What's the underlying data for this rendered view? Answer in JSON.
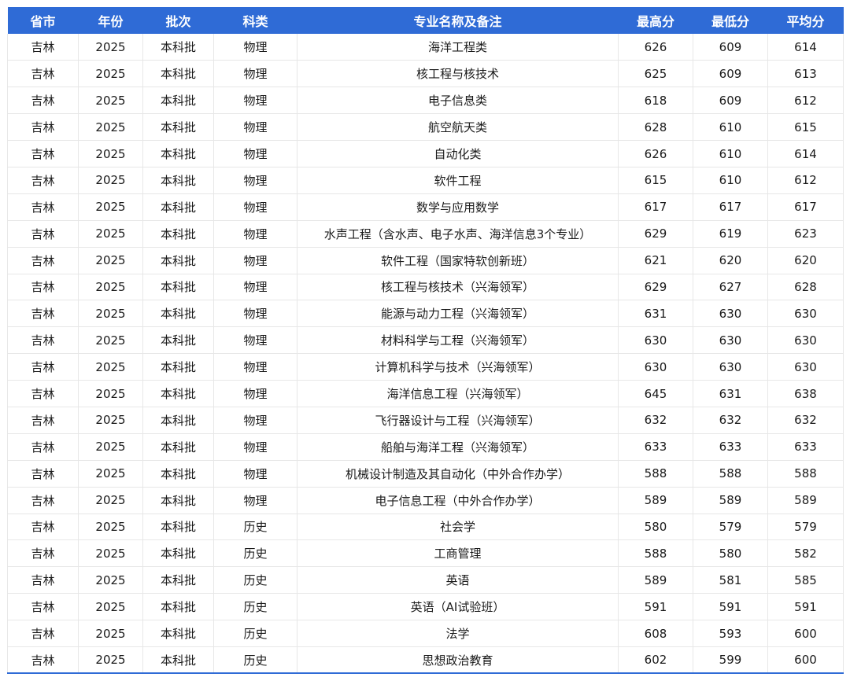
{
  "table": {
    "headers": [
      "省市",
      "年份",
      "批次",
      "科类",
      "专业名称及备注",
      "最高分",
      "最低分",
      "平均分"
    ],
    "rows": [
      [
        "吉林",
        "2025",
        "本科批",
        "物理",
        "海洋工程类",
        "626",
        "609",
        "614"
      ],
      [
        "吉林",
        "2025",
        "本科批",
        "物理",
        "核工程与核技术",
        "625",
        "609",
        "613"
      ],
      [
        "吉林",
        "2025",
        "本科批",
        "物理",
        "电子信息类",
        "618",
        "609",
        "612"
      ],
      [
        "吉林",
        "2025",
        "本科批",
        "物理",
        "航空航天类",
        "628",
        "610",
        "615"
      ],
      [
        "吉林",
        "2025",
        "本科批",
        "物理",
        "自动化类",
        "626",
        "610",
        "614"
      ],
      [
        "吉林",
        "2025",
        "本科批",
        "物理",
        "软件工程",
        "615",
        "610",
        "612"
      ],
      [
        "吉林",
        "2025",
        "本科批",
        "物理",
        "数学与应用数学",
        "617",
        "617",
        "617"
      ],
      [
        "吉林",
        "2025",
        "本科批",
        "物理",
        "水声工程（含水声、电子水声、海洋信息3个专业）",
        "629",
        "619",
        "623"
      ],
      [
        "吉林",
        "2025",
        "本科批",
        "物理",
        "软件工程（国家特软创新班）",
        "621",
        "620",
        "620"
      ],
      [
        "吉林",
        "2025",
        "本科批",
        "物理",
        "核工程与核技术（兴海领军）",
        "629",
        "627",
        "628"
      ],
      [
        "吉林",
        "2025",
        "本科批",
        "物理",
        "能源与动力工程（兴海领军）",
        "631",
        "630",
        "630"
      ],
      [
        "吉林",
        "2025",
        "本科批",
        "物理",
        "材料科学与工程（兴海领军）",
        "630",
        "630",
        "630"
      ],
      [
        "吉林",
        "2025",
        "本科批",
        "物理",
        "计算机科学与技术（兴海领军）",
        "630",
        "630",
        "630"
      ],
      [
        "吉林",
        "2025",
        "本科批",
        "物理",
        "海洋信息工程（兴海领军）",
        "645",
        "631",
        "638"
      ],
      [
        "吉林",
        "2025",
        "本科批",
        "物理",
        "飞行器设计与工程（兴海领军）",
        "632",
        "632",
        "632"
      ],
      [
        "吉林",
        "2025",
        "本科批",
        "物理",
        "船舶与海洋工程（兴海领军）",
        "633",
        "633",
        "633"
      ],
      [
        "吉林",
        "2025",
        "本科批",
        "物理",
        "机械设计制造及其自动化（中外合作办学）",
        "588",
        "588",
        "588"
      ],
      [
        "吉林",
        "2025",
        "本科批",
        "物理",
        "电子信息工程（中外合作办学）",
        "589",
        "589",
        "589"
      ],
      [
        "吉林",
        "2025",
        "本科批",
        "历史",
        "社会学",
        "580",
        "579",
        "579"
      ],
      [
        "吉林",
        "2025",
        "本科批",
        "历史",
        "工商管理",
        "588",
        "580",
        "582"
      ],
      [
        "吉林",
        "2025",
        "本科批",
        "历史",
        "英语",
        "589",
        "581",
        "585"
      ],
      [
        "吉林",
        "2025",
        "本科批",
        "历史",
        "英语（AI试验班）",
        "591",
        "591",
        "591"
      ],
      [
        "吉林",
        "2025",
        "本科批",
        "历史",
        "法学",
        "608",
        "593",
        "600"
      ],
      [
        "吉林",
        "2025",
        "本科批",
        "历史",
        "思想政治教育",
        "602",
        "599",
        "600"
      ]
    ]
  },
  "colors": {
    "header_bg": "#2f6bd6",
    "header_text": "#ffffff",
    "grid_line": "#e7e7e7"
  }
}
